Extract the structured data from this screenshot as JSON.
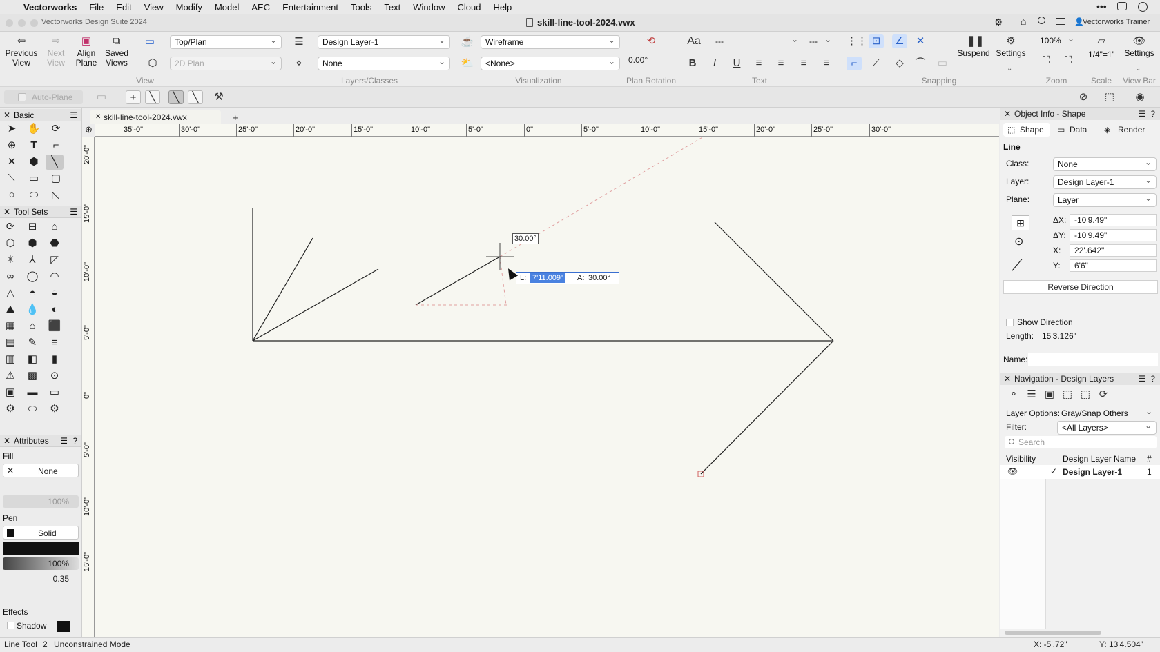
{
  "menubar": {
    "app_name": "Vectorworks",
    "items": [
      "File",
      "Edit",
      "View",
      "Modify",
      "Model",
      "AEC",
      "Entertainment",
      "Tools",
      "Text",
      "Window",
      "Cloud",
      "Help"
    ]
  },
  "titlebar": {
    "app_title": "Vectorworks Design Suite 2024",
    "doc_title": "skill-line-tool-2024.vwx",
    "account": "Vectorworks Trainer"
  },
  "toolbar": {
    "previous_view": "Previous View",
    "next_view": "Next View",
    "align_plane": "Align Plane",
    "saved_views": "Saved Views",
    "view_select": "Top/Plan",
    "render_select": "2D Plan",
    "layer_select": "Design Layer-1",
    "class_select": "None",
    "render_mode": "Wireframe",
    "light_select": "<None>",
    "plan_rotation": "0.00°",
    "text_font": "---",
    "text_size": "---",
    "suspend": "Suspend",
    "settings": "Settings",
    "zoom": "100%",
    "scale": "1/4\"=1'",
    "settings2": "Settings",
    "groups": {
      "view": "View",
      "layers_classes": "Layers/Classes",
      "visualization": "Visualization",
      "plan_rotation": "Plan Rotation",
      "text": "Text",
      "snapping": "Snapping",
      "zoom": "Zoom",
      "scale": "Scale",
      "view_bar": "View Bar"
    }
  },
  "modebar": {
    "auto_plane": "Auto-Plane"
  },
  "palettes": {
    "basic": "Basic",
    "tool_sets": "Tool Sets",
    "attributes": "Attributes",
    "fill_label": "Fill",
    "fill_value": "None",
    "fill_opacity": "100%",
    "pen_label": "Pen",
    "pen_value": "Solid",
    "pen_opacity": "100%",
    "line_weight": "0.35",
    "effects": "Effects",
    "shadow": "Shadow"
  },
  "document_tab": "skill-line-tool-2024.vwx",
  "rulers": {
    "horizontal": [
      "35'-0\"",
      "30'-0\"",
      "25'-0\"",
      "20'-0\"",
      "15'-0\"",
      "10'-0\"",
      "5'-0\"",
      "0\"",
      "5'-0\"",
      "10'-0\"",
      "15'-0\"",
      "20'-0\"",
      "25'-0\"",
      "30'-0\""
    ],
    "vertical": [
      "20'-0\"",
      "15'-0\"",
      "10'-0\"",
      "5'-0\"",
      "0\"",
      "5'-0\"",
      "10'-0\"",
      "15'-0\""
    ]
  },
  "canvas": {
    "angle_tag": "30.00°",
    "length_label": "L:",
    "length_value": "7'11.009\"",
    "angle_label": "A:",
    "angle_value": "30.00°"
  },
  "object_info": {
    "title": "Object Info - Shape",
    "tabs": [
      "Shape",
      "Data",
      "Render"
    ],
    "object_type": "Line",
    "class_label": "Class:",
    "class_value": "None",
    "layer_label": "Layer:",
    "layer_value": "Design Layer-1",
    "plane_label": "Plane:",
    "plane_value": "Layer",
    "dx_label": "ΔX:",
    "dx_value": "-10'9.49\"",
    "dy_label": "ΔY:",
    "dy_value": "-10'9.49\"",
    "x_label": "X:",
    "x_value": "22'.642\"",
    "y_label": "Y:",
    "y_value": "6'6\"",
    "reverse_direction": "Reverse Direction",
    "show_direction": "Show Direction",
    "length_label": "Length:",
    "length_value": "15'3.126\"",
    "name_label": "Name:"
  },
  "navigation": {
    "title": "Navigation - Design Layers",
    "layer_options_label": "Layer Options:",
    "layer_options_value": "Gray/Snap Others",
    "filter_label": "Filter:",
    "filter_value": "<All Layers>",
    "search_placeholder": "Search",
    "col_visibility": "Visibility",
    "col_name": "Design Layer Name",
    "col_num": "#",
    "rows": [
      {
        "name": "Design Layer-1",
        "num": "1"
      }
    ]
  },
  "statusbar": {
    "tool": "Line Tool",
    "mode_num": "2",
    "mode": "Unconstrained Mode",
    "x": "X: -5'.72\"",
    "y": "Y: 13'4.504\""
  }
}
